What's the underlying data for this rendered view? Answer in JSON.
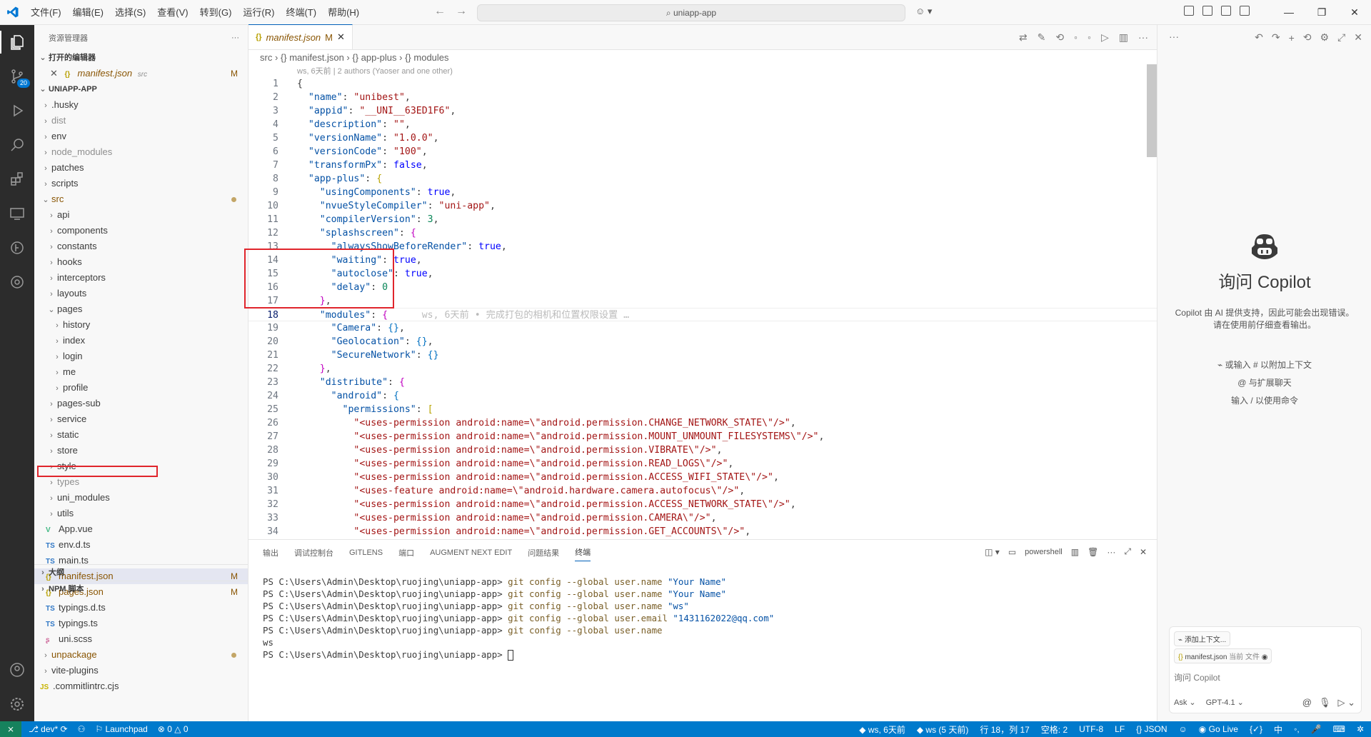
{
  "titlebar": {
    "menus": [
      "文件(F)",
      "编辑(E)",
      "选择(S)",
      "查看(V)",
      "转到(G)",
      "运行(R)",
      "终端(T)",
      "帮助(H)"
    ],
    "search": "uniapp-app"
  },
  "activity": {
    "scm_badge": "20"
  },
  "sidebar": {
    "title": "资源管理器",
    "open_editors_label": "打开的编辑器",
    "open_editor": {
      "name": "manifest.json",
      "hint": "src",
      "badge": "M"
    },
    "project_label": "UNIAPP-APP",
    "outline_label": "大纲",
    "npm_label": "NPM 脚本",
    "tree": [
      {
        "name": ".husky",
        "depth": 0,
        "folder": true,
        "dim": false
      },
      {
        "name": "dist",
        "depth": 0,
        "folder": true,
        "dim": true
      },
      {
        "name": "env",
        "depth": 0,
        "folder": true,
        "dim": false
      },
      {
        "name": "node_modules",
        "depth": 0,
        "folder": true,
        "dim": true
      },
      {
        "name": "patches",
        "depth": 0,
        "folder": true,
        "dim": false
      },
      {
        "name": "scripts",
        "depth": 0,
        "folder": true,
        "dim": false
      },
      {
        "name": "src",
        "depth": 0,
        "folder": true,
        "open": true,
        "mod": true,
        "dot": true
      },
      {
        "name": "api",
        "depth": 1,
        "folder": true
      },
      {
        "name": "components",
        "depth": 1,
        "folder": true
      },
      {
        "name": "constants",
        "depth": 1,
        "folder": true
      },
      {
        "name": "hooks",
        "depth": 1,
        "folder": true
      },
      {
        "name": "interceptors",
        "depth": 1,
        "folder": true
      },
      {
        "name": "layouts",
        "depth": 1,
        "folder": true
      },
      {
        "name": "pages",
        "depth": 1,
        "folder": true,
        "open": true
      },
      {
        "name": "history",
        "depth": 2,
        "folder": true
      },
      {
        "name": "index",
        "depth": 2,
        "folder": true
      },
      {
        "name": "login",
        "depth": 2,
        "folder": true
      },
      {
        "name": "me",
        "depth": 2,
        "folder": true
      },
      {
        "name": "profile",
        "depth": 2,
        "folder": true
      },
      {
        "name": "pages-sub",
        "depth": 1,
        "folder": true
      },
      {
        "name": "service",
        "depth": 1,
        "folder": true
      },
      {
        "name": "static",
        "depth": 1,
        "folder": true
      },
      {
        "name": "store",
        "depth": 1,
        "folder": true
      },
      {
        "name": "style",
        "depth": 1,
        "folder": true
      },
      {
        "name": "types",
        "depth": 1,
        "folder": true,
        "dim": true
      },
      {
        "name": "uni_modules",
        "depth": 1,
        "folder": true
      },
      {
        "name": "utils",
        "depth": 1,
        "folder": true
      },
      {
        "name": "App.vue",
        "depth": 1,
        "icon": "V",
        "iconColor": "#41b883"
      },
      {
        "name": "env.d.ts",
        "depth": 1,
        "icon": "TS",
        "iconColor": "#3178c6"
      },
      {
        "name": "main.ts",
        "depth": 1,
        "icon": "TS",
        "iconColor": "#3178c6"
      },
      {
        "name": "manifest.json",
        "depth": 1,
        "icon": "{}",
        "iconColor": "#b8a000",
        "mod": true,
        "badge": "M",
        "selected": true
      },
      {
        "name": "pages.json",
        "depth": 1,
        "icon": "{}",
        "iconColor": "#b8a000",
        "mod": true,
        "badge": "M"
      },
      {
        "name": "typings.d.ts",
        "depth": 1,
        "icon": "TS",
        "iconColor": "#3178c6"
      },
      {
        "name": "typings.ts",
        "depth": 1,
        "icon": "TS",
        "iconColor": "#3178c6"
      },
      {
        "name": "uni.scss",
        "depth": 1,
        "icon": "ʂ",
        "iconColor": "#cd6799"
      },
      {
        "name": "unpackage",
        "depth": 0,
        "folder": true,
        "mod": true,
        "dot": true
      },
      {
        "name": "vite-plugins",
        "depth": 0,
        "folder": true
      },
      {
        "name": ".commitlintrc.cjs",
        "depth": 0,
        "icon": "JS",
        "iconColor": "#c7b300"
      }
    ]
  },
  "editor": {
    "tab": {
      "name": "manifest.json",
      "badge": "M"
    },
    "breadcrumb": [
      "src",
      "{} manifest.json",
      "{} app-plus",
      "{} modules"
    ],
    "blame": "ws, 6天前 | 2 authors (Yaoser and one other)",
    "inline_blame": "ws, 6天前 • 完成打包的相机和位置权限设置 …",
    "current_line": 18
  },
  "panel": {
    "tabs": [
      "输出",
      "调试控制台",
      "GITLENS",
      "端口",
      "AUGMENT NEXT EDIT",
      "问题结果",
      "终端"
    ],
    "active": "终端",
    "shell": "powershell",
    "terminal": [
      {
        "prompt": "PS C:\\Users\\Admin\\Desktop\\ruojing\\uniapp-app> ",
        "cmd": "git config --global user.name ",
        "arg": "\"Your Name\""
      },
      {
        "prompt": "PS C:\\Users\\Admin\\Desktop\\ruojing\\uniapp-app> ",
        "cmd": "git config --global user.name ",
        "arg": "\"Your Name\""
      },
      {
        "prompt": "PS C:\\Users\\Admin\\Desktop\\ruojing\\uniapp-app> ",
        "cmd": "git config --global user.name ",
        "arg": "\"ws\""
      },
      {
        "prompt": "PS C:\\Users\\Admin\\Desktop\\ruojing\\uniapp-app> ",
        "cmd": "git config --global user.email ",
        "arg": "\"1431162022@qq.com\""
      },
      {
        "prompt": "PS C:\\Users\\Admin\\Desktop\\ruojing\\uniapp-app> ",
        "cmd": "git config --global user.name",
        "arg": ""
      },
      {
        "prompt": "ws",
        "cmd": "",
        "arg": ""
      },
      {
        "prompt": "PS C:\\Users\\Admin\\Desktop\\ruojing\\uniapp-app> ",
        "cmd": "",
        "arg": "",
        "cursor": true
      }
    ]
  },
  "copilot": {
    "title": "询问 Copilot",
    "desc": "Copilot 由 AI 提供支持，因此可能会出现错误。请在使用前仔细查看输出。",
    "hint1": "或输入 # 以附加上下文",
    "hint2": "与扩展聊天",
    "hint3": "输入 / 以使用命令",
    "add_context": "添加上下文...",
    "file_chip": "manifest.json",
    "file_chip_hint": "当前 文件",
    "placeholder": "询问 Copilot",
    "mode": "Ask",
    "model": "GPT-4.1"
  },
  "status": {
    "branch": "dev*",
    "launchpad": "Launchpad",
    "problems": "0",
    "warnings": "0",
    "blame": "ws, 6天前",
    "author": "ws (5 天前)",
    "position": "行 18，列 17",
    "spaces": "空格: 2",
    "encoding": "UTF-8",
    "eol": "LF",
    "language": "JSON",
    "golive": "Go Live"
  },
  "code": [
    [
      [
        "p",
        "{"
      ]
    ],
    [
      [
        "p",
        "  "
      ],
      [
        "k",
        "\"name\""
      ],
      [
        "p",
        ": "
      ],
      [
        "s",
        "\"unibest\""
      ],
      [
        "p",
        ","
      ]
    ],
    [
      [
        "p",
        "  "
      ],
      [
        "k",
        "\"appid\""
      ],
      [
        "p",
        ": "
      ],
      [
        "s",
        "\"__UNI__63ED1F6\""
      ],
      [
        "p",
        ","
      ]
    ],
    [
      [
        "p",
        "  "
      ],
      [
        "k",
        "\"description\""
      ],
      [
        "p",
        ": "
      ],
      [
        "s",
        "\"\""
      ],
      [
        "p",
        ","
      ]
    ],
    [
      [
        "p",
        "  "
      ],
      [
        "k",
        "\"versionName\""
      ],
      [
        "p",
        ": "
      ],
      [
        "s",
        "\"1.0.0\""
      ],
      [
        "p",
        ","
      ]
    ],
    [
      [
        "p",
        "  "
      ],
      [
        "k",
        "\"versionCode\""
      ],
      [
        "p",
        ": "
      ],
      [
        "s",
        "\"100\""
      ],
      [
        "p",
        ","
      ]
    ],
    [
      [
        "p",
        "  "
      ],
      [
        "k",
        "\"transformPx\""
      ],
      [
        "p",
        ": "
      ],
      [
        "b",
        "false"
      ],
      [
        "p",
        ","
      ]
    ],
    [
      [
        "p",
        "  "
      ],
      [
        "k",
        "\"app-plus\""
      ],
      [
        "p",
        ": "
      ],
      [
        "br1",
        "{"
      ]
    ],
    [
      [
        "p",
        "    "
      ],
      [
        "k",
        "\"usingComponents\""
      ],
      [
        "p",
        ": "
      ],
      [
        "b",
        "true"
      ],
      [
        "p",
        ","
      ]
    ],
    [
      [
        "p",
        "    "
      ],
      [
        "k",
        "\"nvueStyleCompiler\""
      ],
      [
        "p",
        ": "
      ],
      [
        "s",
        "\"uni-app\""
      ],
      [
        "p",
        ","
      ]
    ],
    [
      [
        "p",
        "    "
      ],
      [
        "k",
        "\"compilerVersion\""
      ],
      [
        "p",
        ": "
      ],
      [
        "n",
        "3"
      ],
      [
        "p",
        ","
      ]
    ],
    [
      [
        "p",
        "    "
      ],
      [
        "k",
        "\"splashscreen\""
      ],
      [
        "p",
        ": "
      ],
      [
        "br2",
        "{"
      ]
    ],
    [
      [
        "p",
        "      "
      ],
      [
        "k",
        "\"alwaysShowBeforeRender\""
      ],
      [
        "p",
        ": "
      ],
      [
        "b",
        "true"
      ],
      [
        "p",
        ","
      ]
    ],
    [
      [
        "p",
        "      "
      ],
      [
        "k",
        "\"waiting\""
      ],
      [
        "p",
        ": "
      ],
      [
        "b",
        "true"
      ],
      [
        "p",
        ","
      ]
    ],
    [
      [
        "p",
        "      "
      ],
      [
        "k",
        "\"autoclose\""
      ],
      [
        "p",
        ": "
      ],
      [
        "b",
        "true"
      ],
      [
        "p",
        ","
      ]
    ],
    [
      [
        "p",
        "      "
      ],
      [
        "k",
        "\"delay\""
      ],
      [
        "p",
        ": "
      ],
      [
        "n",
        "0"
      ]
    ],
    [
      [
        "p",
        "    "
      ],
      [
        "br2",
        "}"
      ],
      [
        "p",
        ","
      ]
    ],
    [
      [
        "p",
        "    "
      ],
      [
        "k",
        "\"modules\""
      ],
      [
        "p",
        ": "
      ],
      [
        "br2",
        "{"
      ],
      [
        "ghost",
        "      ws, 6天前 • 完成打包的相机和位置权限设置 …"
      ]
    ],
    [
      [
        "p",
        "      "
      ],
      [
        "k",
        "\"Camera\""
      ],
      [
        "p",
        ": "
      ],
      [
        "br3",
        "{}"
      ],
      [
        "p",
        ","
      ]
    ],
    [
      [
        "p",
        "      "
      ],
      [
        "k",
        "\"Geolocation\""
      ],
      [
        "p",
        ": "
      ],
      [
        "br3",
        "{}"
      ],
      [
        "p",
        ","
      ]
    ],
    [
      [
        "p",
        "      "
      ],
      [
        "k",
        "\"SecureNetwork\""
      ],
      [
        "p",
        ": "
      ],
      [
        "br3",
        "{}"
      ]
    ],
    [
      [
        "p",
        "    "
      ],
      [
        "br2",
        "}"
      ],
      [
        "p",
        ","
      ]
    ],
    [
      [
        "p",
        "    "
      ],
      [
        "k",
        "\"distribute\""
      ],
      [
        "p",
        ": "
      ],
      [
        "br2",
        "{"
      ]
    ],
    [
      [
        "p",
        "      "
      ],
      [
        "k",
        "\"android\""
      ],
      [
        "p",
        ": "
      ],
      [
        "br3",
        "{"
      ]
    ],
    [
      [
        "p",
        "        "
      ],
      [
        "k",
        "\"permissions\""
      ],
      [
        "p",
        ": "
      ],
      [
        "br1",
        "["
      ]
    ],
    [
      [
        "p",
        "          "
      ],
      [
        "s",
        "\"<uses-permission android:name=\\\"android.permission.CHANGE_NETWORK_STATE\\\"/>\""
      ],
      [
        "p",
        ","
      ]
    ],
    [
      [
        "p",
        "          "
      ],
      [
        "s",
        "\"<uses-permission android:name=\\\"android.permission.MOUNT_UNMOUNT_FILESYSTEMS\\\"/>\""
      ],
      [
        "p",
        ","
      ]
    ],
    [
      [
        "p",
        "          "
      ],
      [
        "s",
        "\"<uses-permission android:name=\\\"android.permission.VIBRATE\\\"/>\""
      ],
      [
        "p",
        ","
      ]
    ],
    [
      [
        "p",
        "          "
      ],
      [
        "s",
        "\"<uses-permission android:name=\\\"android.permission.READ_LOGS\\\"/>\""
      ],
      [
        "p",
        ","
      ]
    ],
    [
      [
        "p",
        "          "
      ],
      [
        "s",
        "\"<uses-permission android:name=\\\"android.permission.ACCESS_WIFI_STATE\\\"/>\""
      ],
      [
        "p",
        ","
      ]
    ],
    [
      [
        "p",
        "          "
      ],
      [
        "s",
        "\"<uses-feature android:name=\\\"android.hardware.camera.autofocus\\\"/>\""
      ],
      [
        "p",
        ","
      ]
    ],
    [
      [
        "p",
        "          "
      ],
      [
        "s",
        "\"<uses-permission android:name=\\\"android.permission.ACCESS_NETWORK_STATE\\\"/>\""
      ],
      [
        "p",
        ","
      ]
    ],
    [
      [
        "p",
        "          "
      ],
      [
        "s",
        "\"<uses-permission android:name=\\\"android.permission.CAMERA\\\"/>\""
      ],
      [
        "p",
        ","
      ]
    ],
    [
      [
        "p",
        "          "
      ],
      [
        "s",
        "\"<uses-permission android:name=\\\"android.permission.GET_ACCOUNTS\\\"/>\""
      ],
      [
        "p",
        ","
      ]
    ]
  ]
}
